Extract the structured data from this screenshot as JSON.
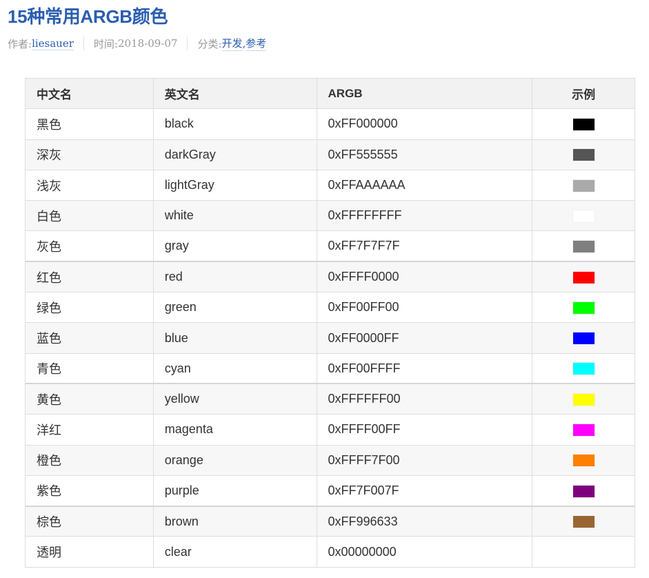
{
  "post": {
    "title": "15种常用ARGB颜色",
    "author_label": "作者: ",
    "author": "liesauer",
    "time_label": "时间: ",
    "time": "2018-09-07",
    "category_label": "分类: ",
    "categories": [
      "开发",
      "参考"
    ]
  },
  "table": {
    "headers": {
      "cn": "中文名",
      "en": "英文名",
      "argb": "ARGB",
      "sample": "示例"
    },
    "rows": [
      {
        "cn": "黑色",
        "en": "black",
        "argb": "0xFF000000",
        "color": "#000000"
      },
      {
        "cn": "深灰",
        "en": "darkGray",
        "argb": "0xFF555555",
        "color": "#555555"
      },
      {
        "cn": "浅灰",
        "en": "lightGray",
        "argb": "0xFFAAAAAA",
        "color": "#aaaaaa"
      },
      {
        "cn": "白色",
        "en": "white",
        "argb": "0xFFFFFFFF",
        "color": "#ffffff"
      },
      {
        "cn": "灰色",
        "en": "gray",
        "argb": "0xFF7F7F7F",
        "color": "#7f7f7f"
      },
      {
        "cn": "红色",
        "en": "red",
        "argb": "0xFFFF0000",
        "color": "#ff0000"
      },
      {
        "cn": "绿色",
        "en": "green",
        "argb": "0xFF00FF00",
        "color": "#00ff00"
      },
      {
        "cn": "蓝色",
        "en": "blue",
        "argb": "0xFF0000FF",
        "color": "#0000ff"
      },
      {
        "cn": "青色",
        "en": "cyan",
        "argb": "0xFF00FFFF",
        "color": "#00ffff"
      },
      {
        "cn": "黄色",
        "en": "yellow",
        "argb": "0xFFFFFF00",
        "color": "#ffff00"
      },
      {
        "cn": "洋红",
        "en": "magenta",
        "argb": "0xFFFF00FF",
        "color": "#ff00ff"
      },
      {
        "cn": "橙色",
        "en": "orange",
        "argb": "0xFFFF7F00",
        "color": "#ff7f00"
      },
      {
        "cn": "紫色",
        "en": "purple",
        "argb": "0xFF7F007F",
        "color": "#7f007f"
      },
      {
        "cn": "棕色",
        "en": "brown",
        "argb": "0xFF996633",
        "color": "#996633"
      },
      {
        "cn": "透明",
        "en": "clear",
        "argb": "0x00000000",
        "color": null
      }
    ]
  }
}
